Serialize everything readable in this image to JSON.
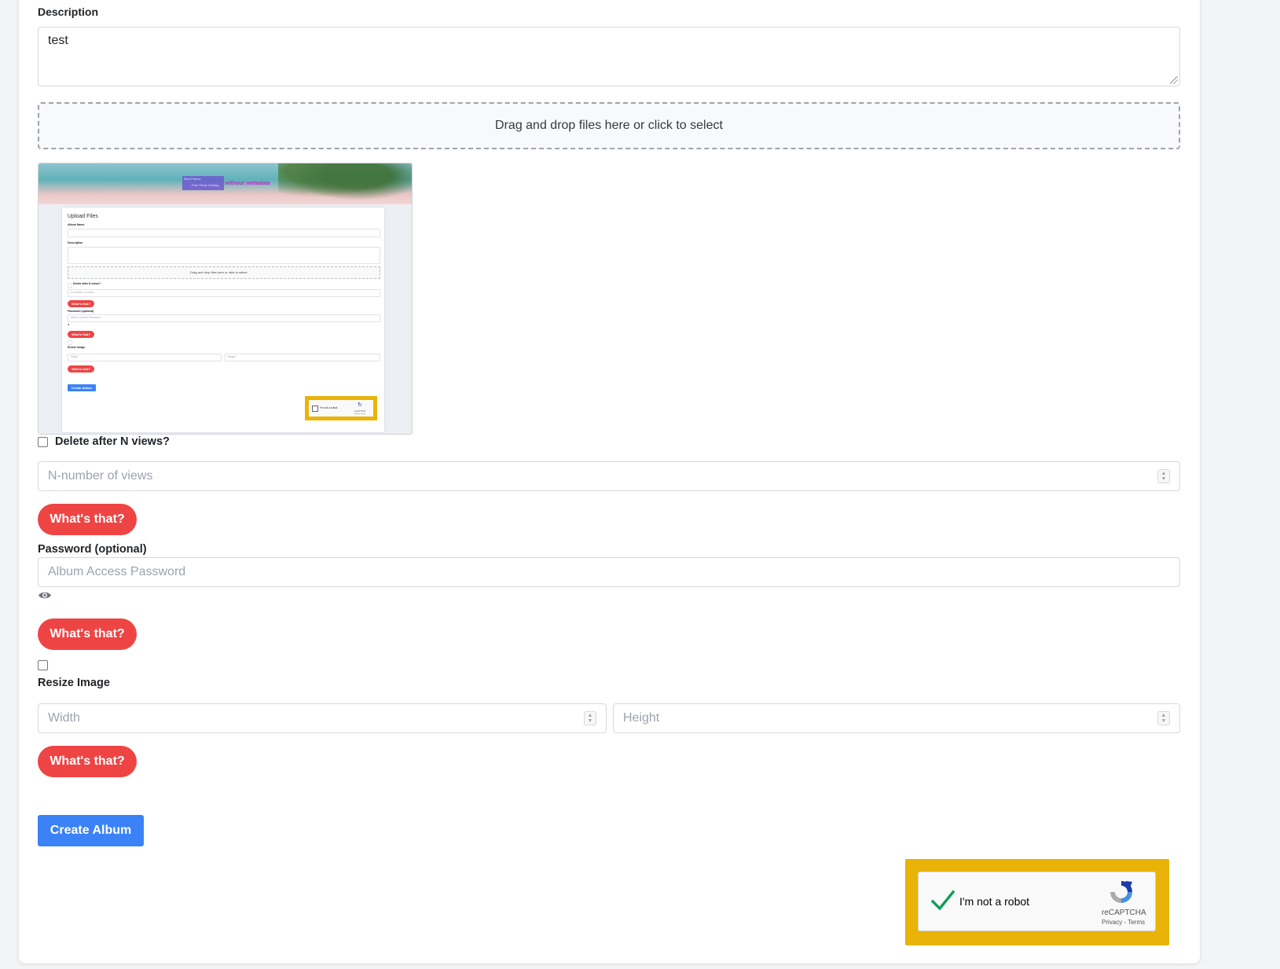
{
  "description": {
    "label": "Description",
    "value": "test"
  },
  "dropzone": {
    "text": "Drag and drop files here or click to select"
  },
  "preview": {
    "banner_text_1": "Best Photos",
    "banner_text_2": "Free Photo Hosting",
    "banner_text_3": "without metadata",
    "title": "Upload Files",
    "album_name_label": "Album Name",
    "description_label": "Description",
    "dropzone_text": "Drag and drop files here or click to select",
    "delete_label": "Delete after N views?",
    "views_placeholder": "N-number of views",
    "whats_that": "What's that?",
    "password_label": "Password (optional)",
    "password_placeholder": "Album Access Password",
    "resize_label": "Resize Image",
    "width_placeholder": "Width",
    "height_placeholder": "Height",
    "create_label": "Create Album",
    "captcha_text": "I'm not a robot",
    "captcha_brand": "reCAPTCHA",
    "captcha_links": "Privacy - Terms"
  },
  "delete_after": {
    "label": "Delete after N views?",
    "placeholder": "N-number of views",
    "help_button": "What's that?"
  },
  "password": {
    "label": "Password (optional)",
    "placeholder": "Album Access Password",
    "help_button": "What's that?"
  },
  "resize": {
    "label": "Resize Image",
    "width_placeholder": "Width",
    "height_placeholder": "Height",
    "help_button": "What's that?"
  },
  "submit": {
    "label": "Create Album"
  },
  "recaptcha": {
    "text": "I'm not a robot",
    "brand": "reCAPTCHA",
    "privacy": "Privacy",
    "separator": "-",
    "terms": "Terms",
    "checked": true
  },
  "colors": {
    "danger": "#ef4444",
    "primary": "#3b82f6",
    "highlight": "#eab308",
    "check": "#0f9d58"
  },
  "icons": {
    "password_toggle": "eye-icon",
    "captcha_check": "checkmark-icon",
    "captcha_logo": "recaptcha-logo-icon"
  }
}
